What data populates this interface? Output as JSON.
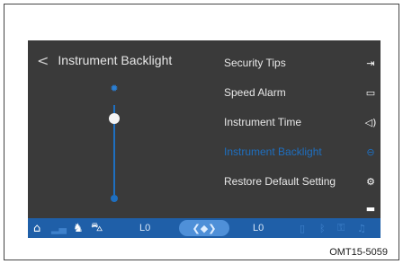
{
  "header": {
    "back_icon": "<",
    "title": "Instrument Backlight"
  },
  "slider": {
    "level_fraction": 0.85,
    "top_icon": "sun-icon",
    "bottom_icon": "dim-sun-icon"
  },
  "menu": {
    "items": [
      {
        "label": "Security Tips",
        "icon": "exit-icon",
        "active": false
      },
      {
        "label": "Speed Alarm",
        "icon": "display-icon",
        "active": false
      },
      {
        "label": "Instrument Time",
        "icon": "sound-icon",
        "active": false
      },
      {
        "label": "Instrument Backlight",
        "icon": "gauge-icon",
        "active": true
      },
      {
        "label": "Restore Default Setting",
        "icon": "gear-icon",
        "active": false
      },
      {
        "label": "",
        "icon": "book-icon",
        "active": false
      }
    ]
  },
  "statusbar": {
    "left_level": "L0",
    "right_level": "L0"
  },
  "caption": "OMT15-5059",
  "colors": {
    "screen_bg": "#3a3a3a",
    "accent_blue": "#1e6fc0",
    "statusbar_bg": "#1f5fa8"
  }
}
